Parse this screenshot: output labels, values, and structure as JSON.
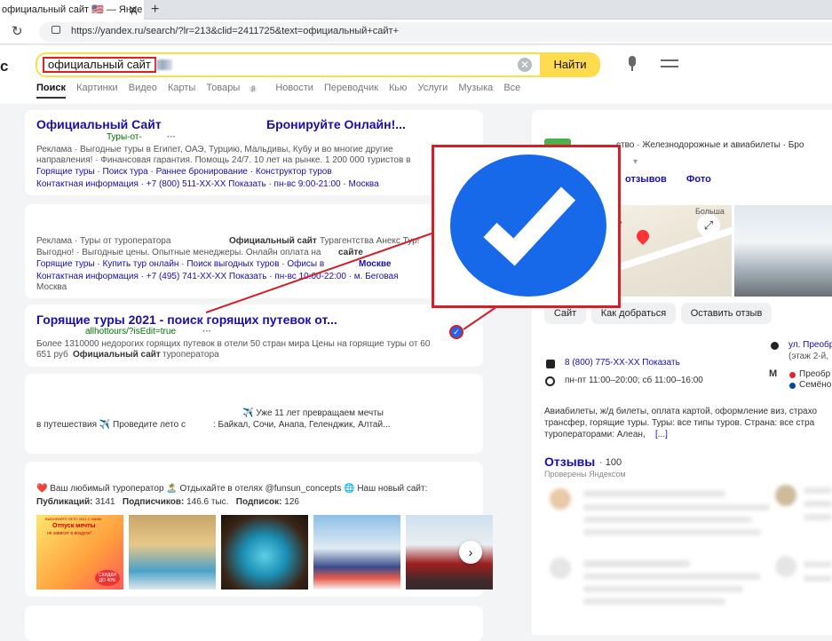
{
  "browser": {
    "tab_title": "официальный сайт 🇺🇸 — Янде",
    "tab_close": "✕",
    "new_tab": "+",
    "reload": "↻",
    "url": "https://yandex.ru/search/?lr=213&clid=2411725&text=официальный+сайт+"
  },
  "header": {
    "logo_fragment": "с",
    "query": "официальный сайт",
    "clear": "✕",
    "find_button": "Найти",
    "tabs": [
      "Поиск",
      "Картинки",
      "Видео",
      "Карты",
      "Товары",
      "Новости",
      "Переводчик",
      "Кью",
      "Услуги",
      "Музыка",
      "Все"
    ],
    "goods_badge": "β"
  },
  "results": {
    "r1": {
      "title": "Официальный Сайт",
      "title2": "Бронируйте Онлайн!...",
      "sub": "Туры-от-",
      "dots": "···",
      "line1": "Реклама · Выгодные туры в Египет, ОАЭ, Турцию, Мальдивы, Кубу и во многие другие",
      "line2": "направления! · Финансовая гарантия. Помощь 24/7. 10 лет на рынке. 1 200 000 туристов в",
      "links": "Горящие туры  ·  Поиск тура  ·  Раннее бронирование  ·  Конструктор туров",
      "contacts": "Контактная информация  ·  +7 (800) 511-XX-XX Показать  ·  пн-вс 9:00-21:00  ·  Москва"
    },
    "r2": {
      "ad_a": "Реклама · Туры от туроператора",
      "ad_b": "Официальный сайт",
      "ad_c": "Турагентства Анекс Тур!",
      "line2": "Выгодно! · Выгодные цены. Опытные менеджеры. Онлайн оплата на",
      "line2b": "сайте",
      "links": "Горящие туры  ·  Купить тур онлайн  ·  Поиск выгодных туров  ·  Офисы в",
      "links_city": "Москве",
      "contacts": "Контактная информация  ·  +7 (495) 741-XX-XX Показать  ·  пн-вс 10:00-22:00  ·  м. Беговая",
      "city": "Москва"
    },
    "r3": {
      "title": "Горящие туры 2021 - поиск горящих путевок от...",
      "url": "allhottours/?isEdit=true",
      "dots": "···",
      "desc1": "Более 1310000 недорогих горящих путевок в отели 50 стран мира Цены на горящие туры от 60",
      "desc2a": "651 руб",
      "desc2b": "Официальный сайт",
      "desc2c": "туроператора"
    },
    "r4": {
      "line1": "✈️ Уже 11 лет превращаем мечты",
      "line2a": "в путешествия ✈️ Проведите лето с",
      "line2b": ": Байкал, Сочи, Анапа, Геленджик, Алтай..."
    },
    "r5": {
      "bio": "❤️ Ваш любимый туроператор 🏝️ Отдыхайте в отелях @funsun_concepts 🌐 Наш новый сайт:",
      "pub_label": "Публикаций:",
      "pub_value": "3141",
      "subs_label": "Подписчиков:",
      "subs_value": "146.6 тыс.",
      "follow_label": "Подписок:",
      "follow_value": "126",
      "thumb1_top": "ВЫБИРАЙТЕ ЛЕТО 2021 С НАМИ",
      "thumb1_main": "Отпуск мечты",
      "thumb1_sub": "не зависит в воздухе!",
      "thumb1_cta": "СКИДКИ ДО 40%",
      "scroll_arrow": "›"
    }
  },
  "knowledge": {
    "category": "ство · Железнодорожные и авиабилеты · Бро",
    "caret": "▾",
    "tab_reviews": "отзывов",
    "tab_photo": "Фото",
    "map_street": "Больша",
    "map_expand": "⤢",
    "btn_site": "Сайт",
    "btn_route": "Как добраться",
    "btn_review": "Оставить отзыв",
    "address": "ул. Преобр",
    "address2": "(этаж 2-й,",
    "metro1": "Преобр",
    "metro2": "Семёно",
    "metro_icon": "М",
    "phone": "8 (800) 775-XX-XX Показать",
    "hours": "пн-пт 11:00–20:00; сб 11:00–16:00",
    "about1": "Авиабилеты, ж/д билеты, оплата картой, оформление виз, страхо",
    "about2": "трансфер, горящие туры. Туры: все типы туров. Страна: все стра",
    "about3": "туроператорами: Алеан,",
    "about_more": "[...]",
    "reviews_title": "Отзывы",
    "reviews_count": "· 100",
    "reviews_sub": "Проверены Яндексом"
  },
  "colors": {
    "yandex_yellow": "#ffdb4d",
    "link_blue": "#1a0dab",
    "verified_blue": "#1769ea",
    "highlight_red": "#d2202a"
  }
}
